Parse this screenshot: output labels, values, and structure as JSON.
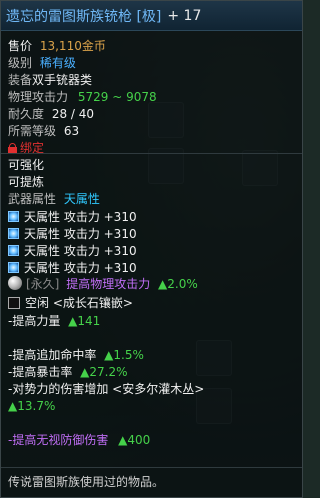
{
  "title": {
    "name": "遗忘的雷图斯族铳枪 [极]",
    "enhance": "+ 17"
  },
  "info": {
    "sell_label": "售价",
    "sell_value": "13,110金币",
    "grade_label": "级别",
    "grade_value": "稀有级",
    "equip_label": "装备",
    "equip_value": "双手铳器类",
    "phys_label": "物理攻击力",
    "phys_value": "5729 ~ 9078",
    "durability_label": "耐久度",
    "durability_value": "28 / 40",
    "level_label": "所需等级",
    "level_value": "63",
    "bound": "绑定"
  },
  "props": {
    "reinforce": "可强化",
    "refine": "可提炼",
    "element_label": "武器属性",
    "element_value": "天属性",
    "elements": [
      "天属性 攻击力 +310",
      "天属性 攻击力 +310",
      "天属性 攻击力 +310",
      "天属性 攻击力 +310"
    ],
    "perm_tag": "[永久]",
    "perm_text": "提高物理攻击力",
    "perm_value": "▲2.0%",
    "socket_text": "空闲 <成长石镶嵌>"
  },
  "stats": {
    "power_label": "-提高力量",
    "power_value": "▲141",
    "crit_dmg_label": "-提高追加命中率",
    "crit_dmg_value": "▲1.5%",
    "crit_label": "-提高暴击率",
    "crit_value": "▲27.2%",
    "faction_label": "-对势力的伤害增加 <安多尔灌木丛>",
    "faction_value": "▲13.7%",
    "ignore_def_label": "-提高无视防御伤害",
    "ignore_def_value": "▲400"
  },
  "footer": {
    "desc": "传说雷图斯族使用过的物品。"
  },
  "colors": {
    "title": "#6fb7f5",
    "grade": "#4ab0ff",
    "gold": "#d9a24a",
    "up": "#45d14a",
    "bound": "#e03030",
    "special": "#c06ef5"
  }
}
